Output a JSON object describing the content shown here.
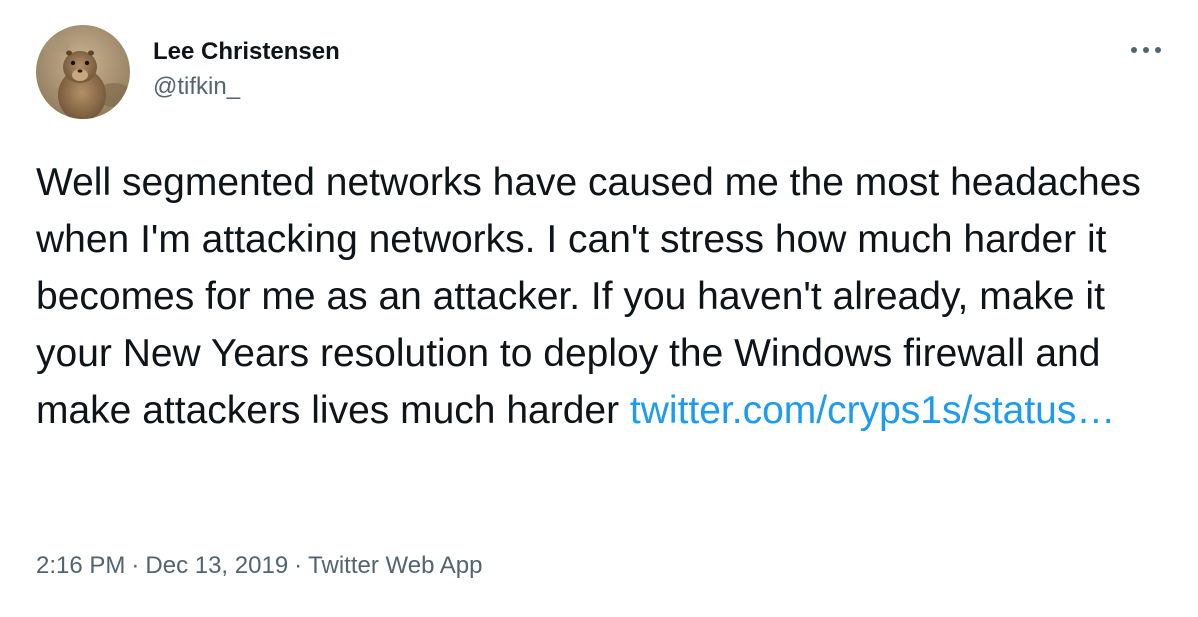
{
  "author": {
    "display_name": "Lee Christensen",
    "handle": "@tifkin_",
    "avatar_icon": "avatar-photo"
  },
  "menu": {
    "icon": "more-horizontal-icon"
  },
  "tweet": {
    "text": "Well segmented networks have caused me the most headaches when I'm attacking networks. I can't stress how much harder it becomes for me as an attacker. If you haven't already, make it your New Years resolution to deploy the Windows firewall and make attackers lives much harder",
    "link_text": "twitter.com/cryps1s/status…"
  },
  "meta": {
    "time": "2:16 PM",
    "separator": "·",
    "date": "Dec 13, 2019",
    "source": "Twitter Web App"
  },
  "colors": {
    "text": "#0f1419",
    "secondary": "#536471",
    "link": "#1d9bf0"
  }
}
